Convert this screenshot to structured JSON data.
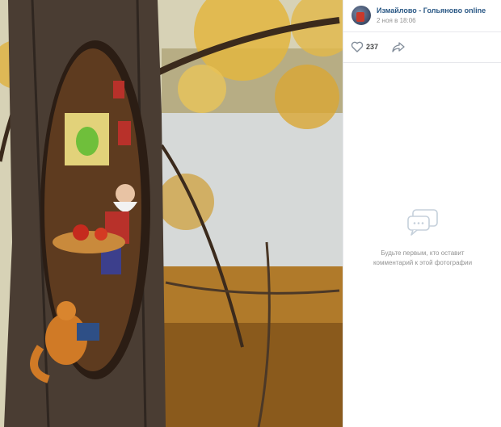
{
  "post": {
    "group_name": "Измайлово - Гольяново online",
    "date": "2 ноя в 18:06",
    "likes": "237"
  },
  "comments": {
    "empty_line1": "Будьте первым, кто оставит",
    "empty_line2": "комментарий к этой фотографии"
  },
  "icons": {
    "like": "heart-icon",
    "share": "share-arrow-icon",
    "comments_empty": "chat-bubbles-icon"
  },
  "colors": {
    "link": "#2a5885",
    "muted": "#939393",
    "divider": "#e7e8ec"
  }
}
